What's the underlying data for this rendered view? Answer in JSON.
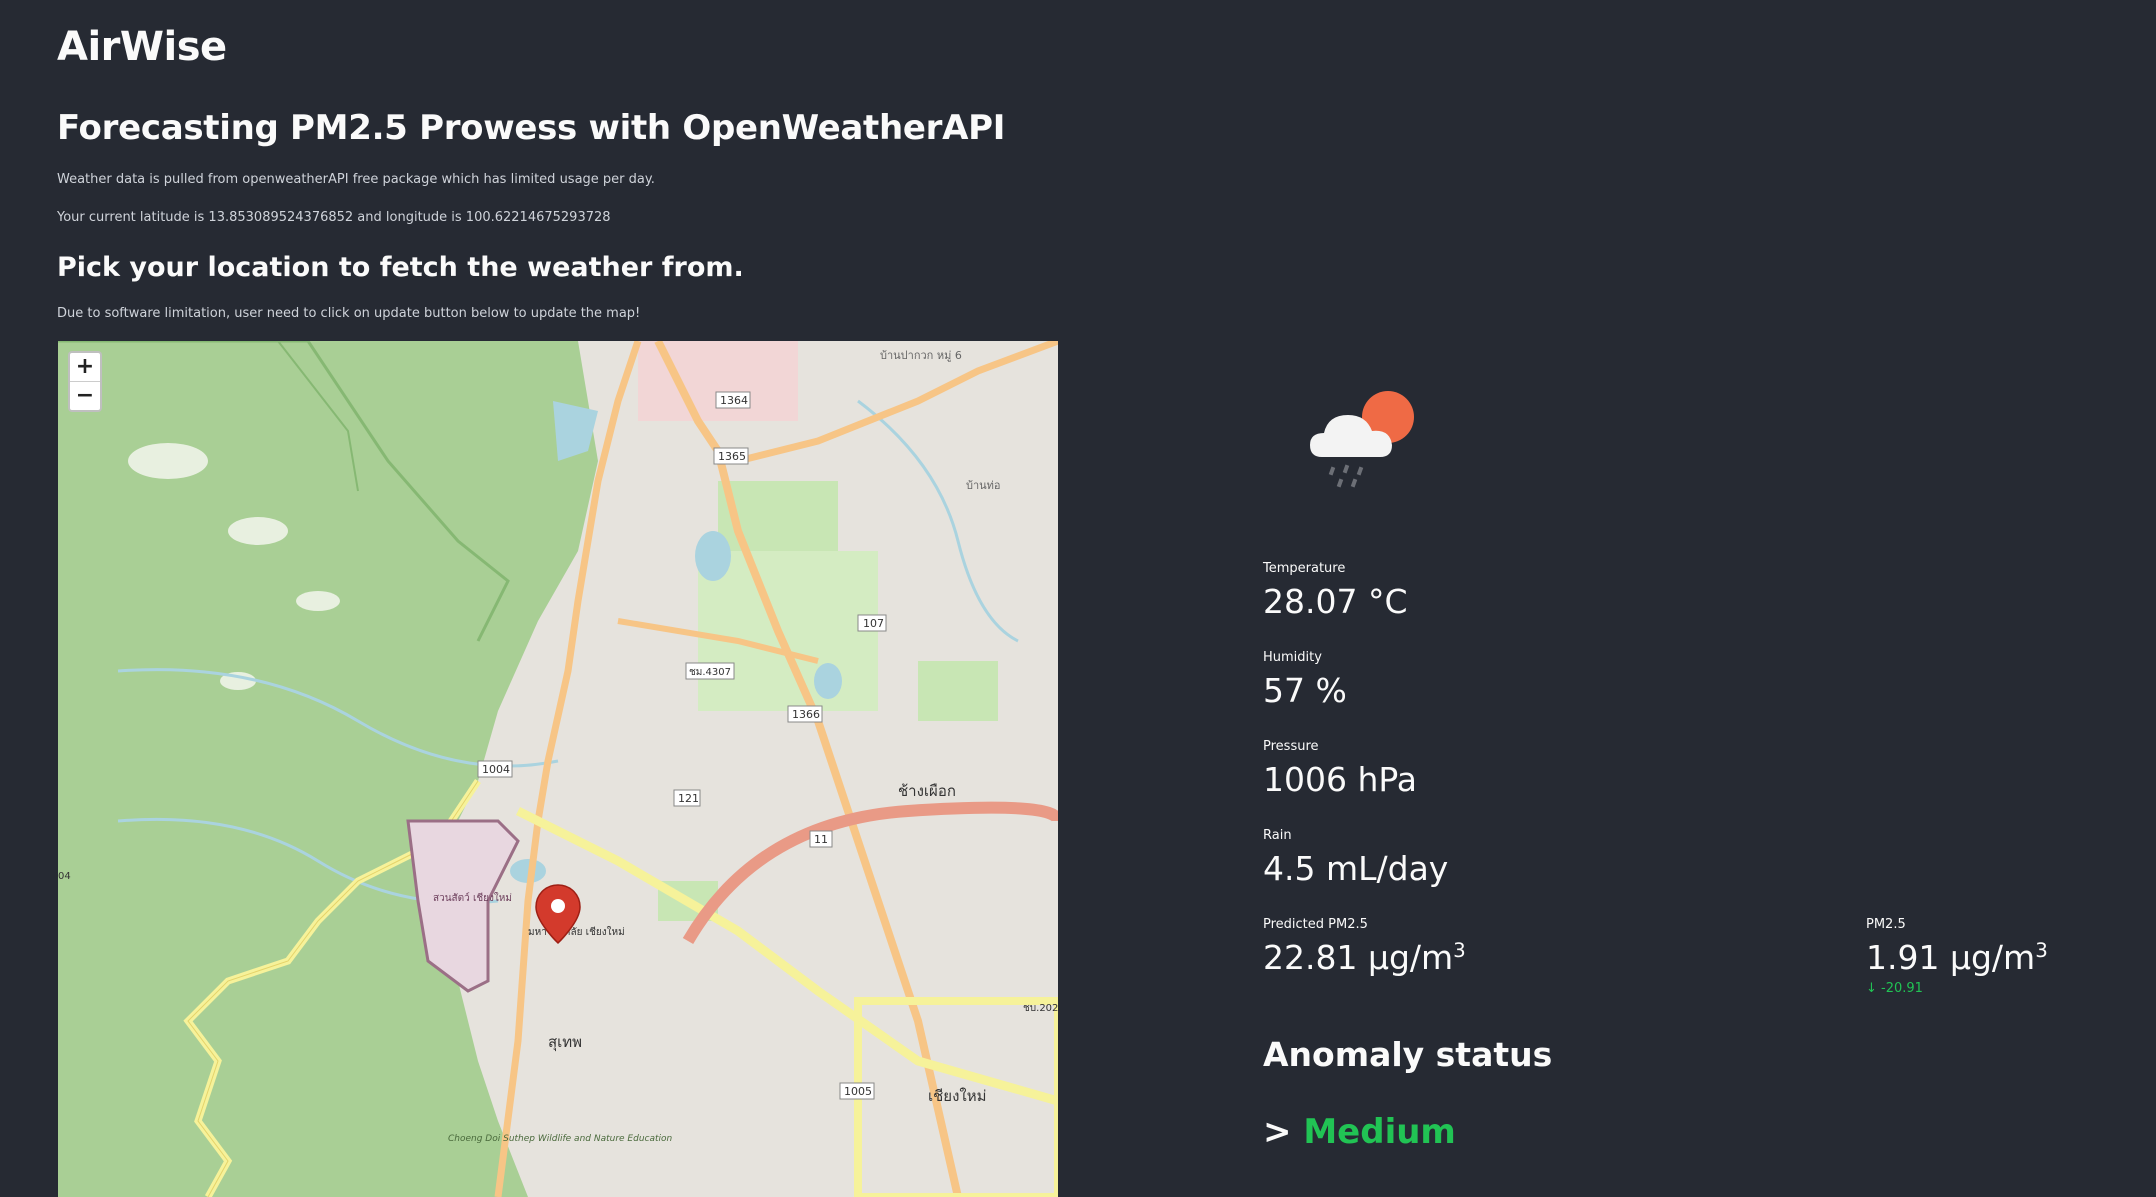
{
  "app": {
    "title": "AirWise",
    "subtitle": "Forecasting PM2.5 Prowess with OpenWeatherAPI",
    "note_api": "Weather data is pulled from openweatherAPI free package which has limited usage per day.",
    "note_location": "Your current latitude is 13.853089524376852 and longitude is 100.62214675293728"
  },
  "location": {
    "heading": "Pick your location to fetch the weather from.",
    "note": "Due to software limitation, user need to click on update button below to update the map!"
  },
  "map": {
    "zoom_in": "+",
    "zoom_out": "−",
    "labels": {
      "r1364": "1364",
      "r1365": "1365",
      "r107": "107",
      "r4307": "ชม.4307",
      "r1366": "1366",
      "r1004": "1004",
      "r121": "121",
      "r11": "11",
      "r1005": "1005",
      "chang_phueak": "ช้างเผือก",
      "chiang_mai": "เชียงใหม่",
      "suthep": "สุเทพ",
      "zoo": "สวนสัตว์ เชียงใหม่",
      "cmu": "มหาวิทยาลัย เชียงใหม่",
      "ban_tawan": "บ้านปากวก หมู่ 6",
      "ban_tao": "บ้านท่อ",
      "park": "Choeng Doi Suthep Wildlife and Nature Education",
      "edge_04": "04",
      "edge_202": "ชบ.202"
    },
    "colors": {
      "forest": "#a9cf95",
      "urban": "#e6e3dd",
      "water": "#aad3df",
      "major_road": "#f7c586",
      "trunk": "#e99a86",
      "protected": "#9b6f86"
    }
  },
  "weather": {
    "icon": "cloud-sun-rain-icon",
    "temperature_label": "Temperature",
    "temperature_value": "28.07 °C",
    "humidity_label": "Humidity",
    "humidity_value": "57 %",
    "pressure_label": "Pressure",
    "pressure_value": "1006 hPa",
    "rain_label": "Rain",
    "rain_value": "4.5 mL/day",
    "predicted_label": "Predicted PM2.5",
    "predicted_value": "22.81 μg/m",
    "pm_label": "PM2.5",
    "pm_value": "1.91 μg/m",
    "pm_delta": "-20.91",
    "unit_exponent": "3"
  },
  "anomaly": {
    "title": "Anomaly status",
    "prefix": ">",
    "level": "Medium",
    "level_color": "#21c354"
  }
}
